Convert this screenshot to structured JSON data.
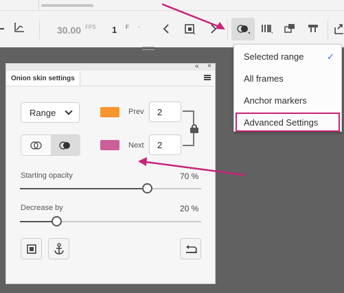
{
  "toolbar": {
    "fps_value": "30.00",
    "fps_unit": "FPS",
    "frame_value": "1",
    "frame_unit": "F",
    "frame_suffix": "·",
    "icons": [
      "graph-icon",
      "prev-frame-icon",
      "stop-icon",
      "next-frame-icon",
      "onion-skin-icon",
      "onion-frames-icon",
      "onion-outline-icon",
      "onion-markers-icon",
      "insert-frame-icon"
    ]
  },
  "onion_menu": {
    "items": [
      {
        "label": "Selected range",
        "checked": true
      },
      {
        "label": "All frames",
        "checked": false
      },
      {
        "label": "Anchor markers",
        "checked": false
      },
      {
        "label": "Advanced Settings",
        "checked": false,
        "highlighted": true
      }
    ],
    "check_glyph": "✓"
  },
  "panel": {
    "collapse_glyph": "«",
    "close_glyph": "×",
    "tab_title": "Onion skin settings",
    "range_select": "Range",
    "prev": {
      "label": "Prev",
      "value": "2",
      "color": "#f7962f"
    },
    "next": {
      "label": "Next",
      "value": "2",
      "color": "#cc5f97"
    },
    "starting_opacity": {
      "label": "Starting opacity",
      "value_text": "70 %",
      "value": 70
    },
    "decrease_by": {
      "label": "Decrease by",
      "value_text": "20 %",
      "value": 20
    }
  },
  "annotation_color": "#c8237a"
}
